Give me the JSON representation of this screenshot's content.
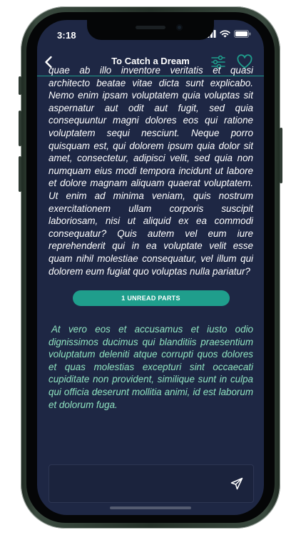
{
  "status_bar": {
    "time": "3:18"
  },
  "nav": {
    "title": "To Catch a Dream",
    "back_icon": "chevron-left-icon",
    "settings_icon": "sliders-icon",
    "favorite_icon": "heart-outline-icon"
  },
  "content": {
    "read_text": "quae ab illo inventore veritatis et quasi architecto beatae vitae dicta sunt explicabo. Nemo enim ipsam voluptatem quia voluptas sit aspernatur aut odit aut fugit, sed quia consequuntur magni dolores eos qui ratione voluptatem sequi nesciunt. Neque porro quisquam est, qui dolorem ipsum quia dolor sit amet, consectetur, adipisci velit, sed quia non numquam eius modi tempora incidunt ut labore et dolore magnam aliquam quaerat voluptatem. Ut enim ad minima veniam, quis nostrum exercitationem ullam corporis suscipit laboriosam, nisi ut aliquid ex ea commodi consequatur? Quis autem vel eum iure reprehenderit qui in ea voluptate velit esse quam nihil molestiae consequatur, vel illum qui dolorem eum fugiat quo voluptas nulla pariatur?",
    "unread_button_label": "1 UNREAD PARTS",
    "unread_text": "At vero eos et accusamus et iusto odio dignissimos ducimus qui blanditiis praesentium voluptatum deleniti atque corrupti quos dolores et quas molestias excepturi sint occaecati cupiditate non provident, similique sunt in culpa qui officia deserunt mollitia animi, id est laborum et dolorum fuga."
  },
  "composer": {
    "send_icon": "send-icon"
  },
  "colors": {
    "background": "#1e2744",
    "accent": "#1f9e8c",
    "unread_text": "#8fe3c0"
  }
}
